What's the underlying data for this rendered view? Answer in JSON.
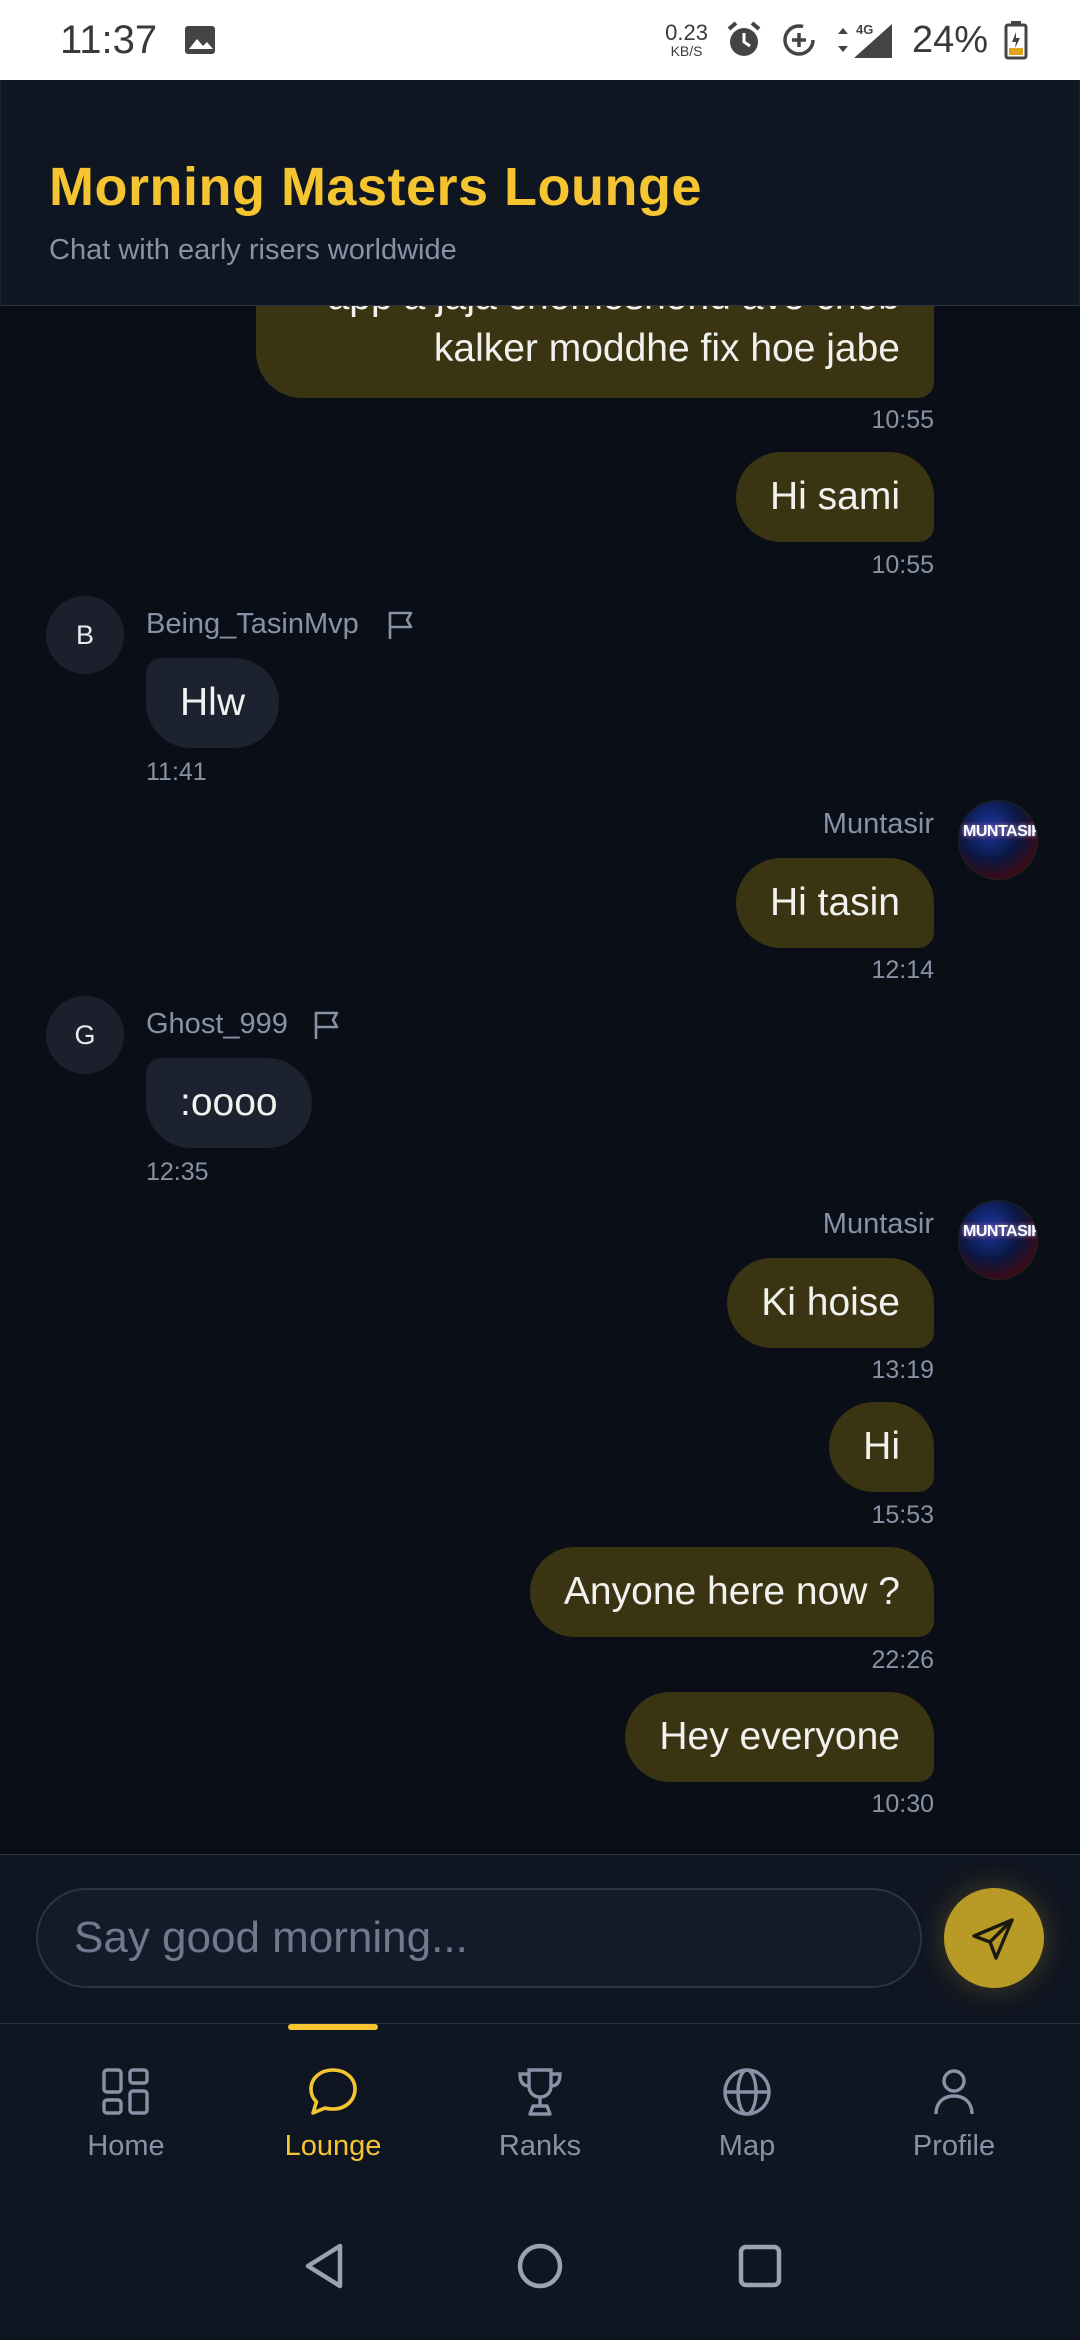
{
  "status_bar": {
    "time": "11:37",
    "speed_value": "0.23",
    "speed_unit": "KB/S",
    "network": "4G",
    "battery": "24%"
  },
  "header": {
    "title": "Morning Masters Lounge",
    "subtitle": "Chat with early risers worldwide"
  },
  "messages": [
    {
      "text_line1": "app a jaja chomoshond ave chob",
      "text_line2": "kalker moddhe fix hoe jabe",
      "time": "10:55"
    },
    {
      "text": "Hi sami",
      "time": "10:55"
    },
    {
      "sender": "Being_TasinMvp",
      "avatar_letter": "B",
      "text": "Hlw",
      "time": "11:41"
    },
    {
      "sender": "Muntasir",
      "text": "Hi tasin",
      "time": "12:14"
    },
    {
      "sender": "Ghost_999",
      "avatar_letter": "G",
      "text": ":oooo",
      "time": "12:35"
    },
    {
      "sender": "Muntasir",
      "text": "Ki hoise",
      "time": "13:19"
    },
    {
      "text": "Hi",
      "time": "15:53"
    },
    {
      "text": "Anyone here now ?",
      "time": "22:26"
    },
    {
      "text": "Hey everyone",
      "time": "10:30"
    }
  ],
  "avatar_text": "MUNTASIR",
  "composer": {
    "placeholder": "Say good morning..."
  },
  "nav": {
    "items": [
      {
        "label": "Home",
        "icon": "grid-icon"
      },
      {
        "label": "Lounge",
        "icon": "chat-bubble-icon",
        "active": true
      },
      {
        "label": "Ranks",
        "icon": "trophy-icon"
      },
      {
        "label": "Map",
        "icon": "globe-icon"
      },
      {
        "label": "Profile",
        "icon": "user-icon"
      }
    ]
  },
  "colors": {
    "accent": "#f5c531",
    "background": "#0a0e16",
    "own_bubble": "#3a3412",
    "other_bubble": "#1d2230",
    "muted_text": "#8792a6"
  }
}
